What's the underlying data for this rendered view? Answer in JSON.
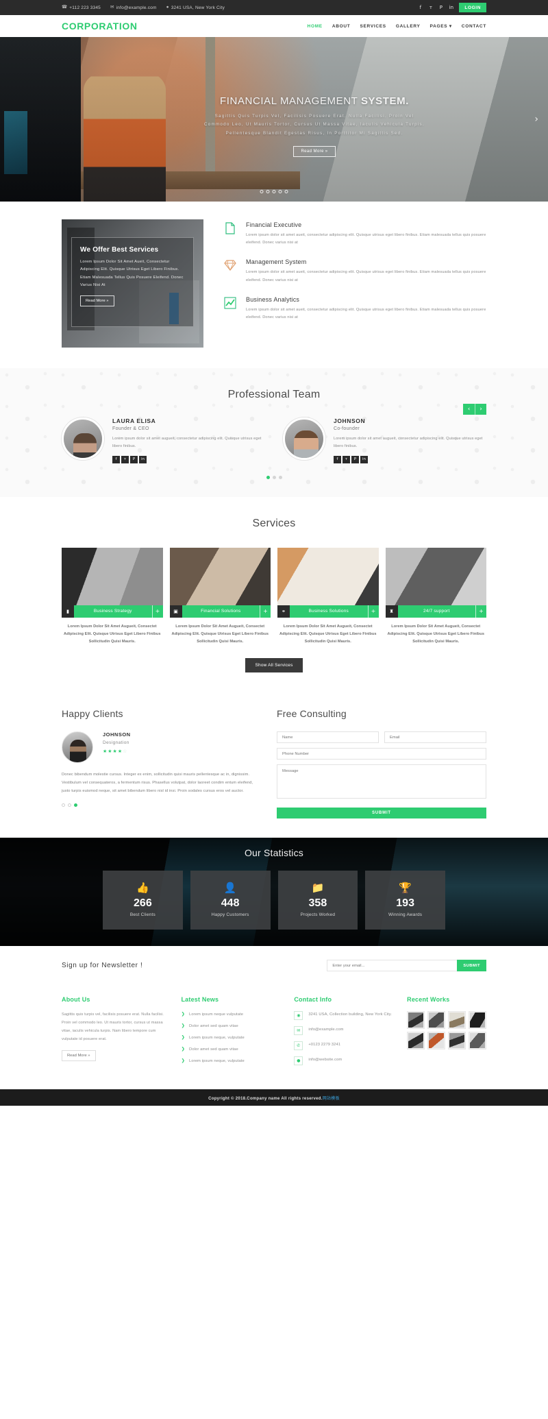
{
  "topbar": {
    "phone": "+112 223 3345",
    "email": "info@example.com",
    "address": "3241 USA, New York City",
    "socials": [
      {
        "name": "facebook-icon",
        "glyph": "f"
      },
      {
        "name": "twitter-icon",
        "glyph": "ᴛ"
      },
      {
        "name": "pinterest-icon",
        "glyph": "P"
      },
      {
        "name": "linkedin-icon",
        "glyph": "in"
      }
    ],
    "login_label": "LOGIN"
  },
  "nav": {
    "brand": "CORPORATION",
    "items": [
      {
        "label": "HOME",
        "active": true
      },
      {
        "label": "ABOUT",
        "active": false
      },
      {
        "label": "SERVICES",
        "active": false
      },
      {
        "label": "GALLERY",
        "active": false
      },
      {
        "label": "PAGES ▾",
        "active": false
      },
      {
        "label": "CONTACT",
        "active": false
      }
    ]
  },
  "hero": {
    "title_light": "FINANCIAL MANAGEMENT ",
    "title_bold": "SYSTEM.",
    "subtitle": "Sagittis Quis Turpis Vel, Facilisis Posuere Erat. Nulla Facilisi. Proin Vel Commodo Leo, Ut Mauris Tortor, Cursus Ut Massa Vitae, Iaculis Vehicula Turpis. Pellentesque Blandit Egestas Risus, In Porttitor Mi Sagittis Sed.",
    "button": "Read More »",
    "next_arrow": "›",
    "dots": 5
  },
  "offer": {
    "heading": "We Offer Best Services",
    "paragraph": "Lorem Ipsum Dolor Sit Amet Aueit, Consectetur Adipiscing Elit. Quisque Utrisus Eget Libero Finibus. Etiam Malesuada Tellus Quis Posuere Eleifend. Donec Varius Nisi At",
    "button": "Read More »",
    "features": [
      {
        "icon": "document-icon",
        "title": "Financial Executive",
        "text": "Lorem ipsum dolor sit amet aueit, consectetur adipiscing elit. Quisque utrisus eget libero finibus. Etiam malesuada tellus quis posuere eleifend. Donec varius nisi at"
      },
      {
        "icon": "diamond-icon",
        "title": "Management System",
        "text": "Lorem ipsum dolor sit amet aueit, consectetur adipiscing elit. Quisque utrisus eget libero finibus. Etiam malesuada tellus quis posuere eleifend. Donec varius nisi at"
      },
      {
        "icon": "chart-line-icon",
        "title": "Business Analytics",
        "text": "Lorem ipsum dolor sit amet aueit, consectetur adipiscing elit. Quisque utrisus eget libero finibus. Etiam malesuada tellus quis posuere eleifend. Donec varius nisi at"
      }
    ]
  },
  "team": {
    "title": "Professional Team",
    "prev": "‹",
    "next": "›",
    "members": [
      {
        "name": "LAURA ELISA",
        "role": "Founder & CEO",
        "desc": "Lorem ipsum dolor sit amet augueit, consectetur adipiscing elit. Quisque utrisus eget libero finibus.",
        "socials": [
          "f",
          "ᴛ",
          "P",
          "in"
        ]
      },
      {
        "name": "JOHNSON",
        "role": "Co-founder",
        "desc": "Lorem ipsum dolor sit amet augueit, consectetur adipiscing elit. Quisque utrisus eget libero finibus.",
        "socials": [
          "f",
          "ᴛ",
          "P",
          "in"
        ]
      }
    ],
    "dots_active_index": 0,
    "dots_count": 3
  },
  "services": {
    "title": "Services",
    "show_all_label": "Show All Services",
    "cards": [
      {
        "icon": "briefcase-icon",
        "glyph": "▮",
        "label": "Business Strategy",
        "text": "Lorem Ipsum Dolor Sit Amet Augueit, Consectet Adipiscing Elit. Quisque Utrisus Eget Libero Finibus Sollicitudin Quisi Mauris.",
        "plus": "+"
      },
      {
        "icon": "camera-icon",
        "glyph": "▣",
        "label": "Financial Solutions",
        "text": "Lorem Ipsum Dolor Sit Amet Augueit, Consectet Adipiscing Elit. Quisque Utrisus Eget Libero Finibus Sollicitudin Quisi Mauris.",
        "plus": "+"
      },
      {
        "icon": "share-icon",
        "glyph": "⚭",
        "label": "Business Solutions",
        "text": "Lorem Ipsum Dolor Sit Amet Augueit, Consectet Adipiscing Elit. Quisque Utrisus Eget Libero Finibus Sollicitudin Quisi Mauris.",
        "plus": "+"
      },
      {
        "icon": "support-icon",
        "glyph": "♜",
        "label": "24/7 support",
        "text": "Lorem Ipsum Dolor Sit Amet Augueit, Consectet Adipiscing Elit. Quisque Utrisus Eget Libero Finibus Sollicitudin Quisi Mauris.",
        "plus": "+"
      }
    ]
  },
  "clients": {
    "title": "Happy Clients",
    "name": "JOHNSON",
    "designation": "Designation",
    "rating_filled": 4,
    "rating_total": 5,
    "body": "Donec bibendum molestie cursus. Integer ex enim, sollicitudin quisi mauris pellentesque ac in, dignissim. Vestibulum vel consequateros, a fermentum risus. Phasellus volutpat, dolor laoreet condim entum eleifend, justo turpis euismod neque, sit amet bibendum libero nisl id insi. Proin sodales cursus eros vel auctor.",
    "dots_active_index": 2,
    "dots_count": 3
  },
  "consulting": {
    "title": "Free Consulting",
    "name_placeholder": "Name",
    "email_placeholder": "Email",
    "phone_placeholder": "Phone Number",
    "message_placeholder": "Message",
    "submit_label": "SUBMIT"
  },
  "statistics": {
    "title": "Our Statistics",
    "items": [
      {
        "icon": "thumbs-up-icon",
        "glyph": "👍",
        "value": "266",
        "label": "Best Clients"
      },
      {
        "icon": "user-icon",
        "glyph": "👤",
        "value": "448",
        "label": "Happy Customers"
      },
      {
        "icon": "folder-icon",
        "glyph": "📁",
        "value": "358",
        "label": "Projects Worked"
      },
      {
        "icon": "trophy-icon",
        "glyph": "🏆",
        "value": "193",
        "label": "Winning Awards"
      }
    ]
  },
  "newsletter": {
    "title": "Sign up for Newsletter !",
    "placeholder": "Enter your email...",
    "submit_label": "SUBMIT"
  },
  "footer": {
    "about": {
      "title": "About Us",
      "text": "Sagittis quis turpis vel, facilisis posuere erat. Nulla facilisi. Proin vel commodo leo. Ut mauris tortor, cursus ut massa vitae, iaculis vehicula turpis. Nam libero tempore cum vulputate id posuere erat.",
      "button": "Read More »"
    },
    "latest_news": {
      "title": "Latest News",
      "items": [
        "Lorem ipsum neque vulputate",
        "Dolor amet sed quam vitae",
        "Lorem ipsum neque, vulputate",
        "Dolor amet sed quam vitae",
        "Lorem ipsum neque, vulputate"
      ]
    },
    "contact": {
      "title": "Contact Info",
      "items": [
        {
          "icon": "map-pin-icon",
          "glyph": "◉",
          "text": "3241 USA, Collection building, New York City."
        },
        {
          "icon": "envelope-icon",
          "glyph": "✉",
          "text": "info@example.com"
        },
        {
          "icon": "phone-icon",
          "glyph": "✆",
          "text": "+0123 2279 3241"
        },
        {
          "icon": "globe-icon",
          "glyph": "●",
          "text": "info@website.com"
        }
      ]
    },
    "recent_works": {
      "title": "Recent Works",
      "thumbs": [
        "t1",
        "t2",
        "t3",
        "t4",
        "t5",
        "t6",
        "t7",
        "t8"
      ]
    },
    "copyright_main": "Copyright © 2018.Company name All rights reserved.",
    "copyright_extra": "网站模板"
  },
  "colors": {
    "accent": "#2ecc71",
    "dark": "#2b2b2b",
    "text": "#8a8a8a"
  }
}
